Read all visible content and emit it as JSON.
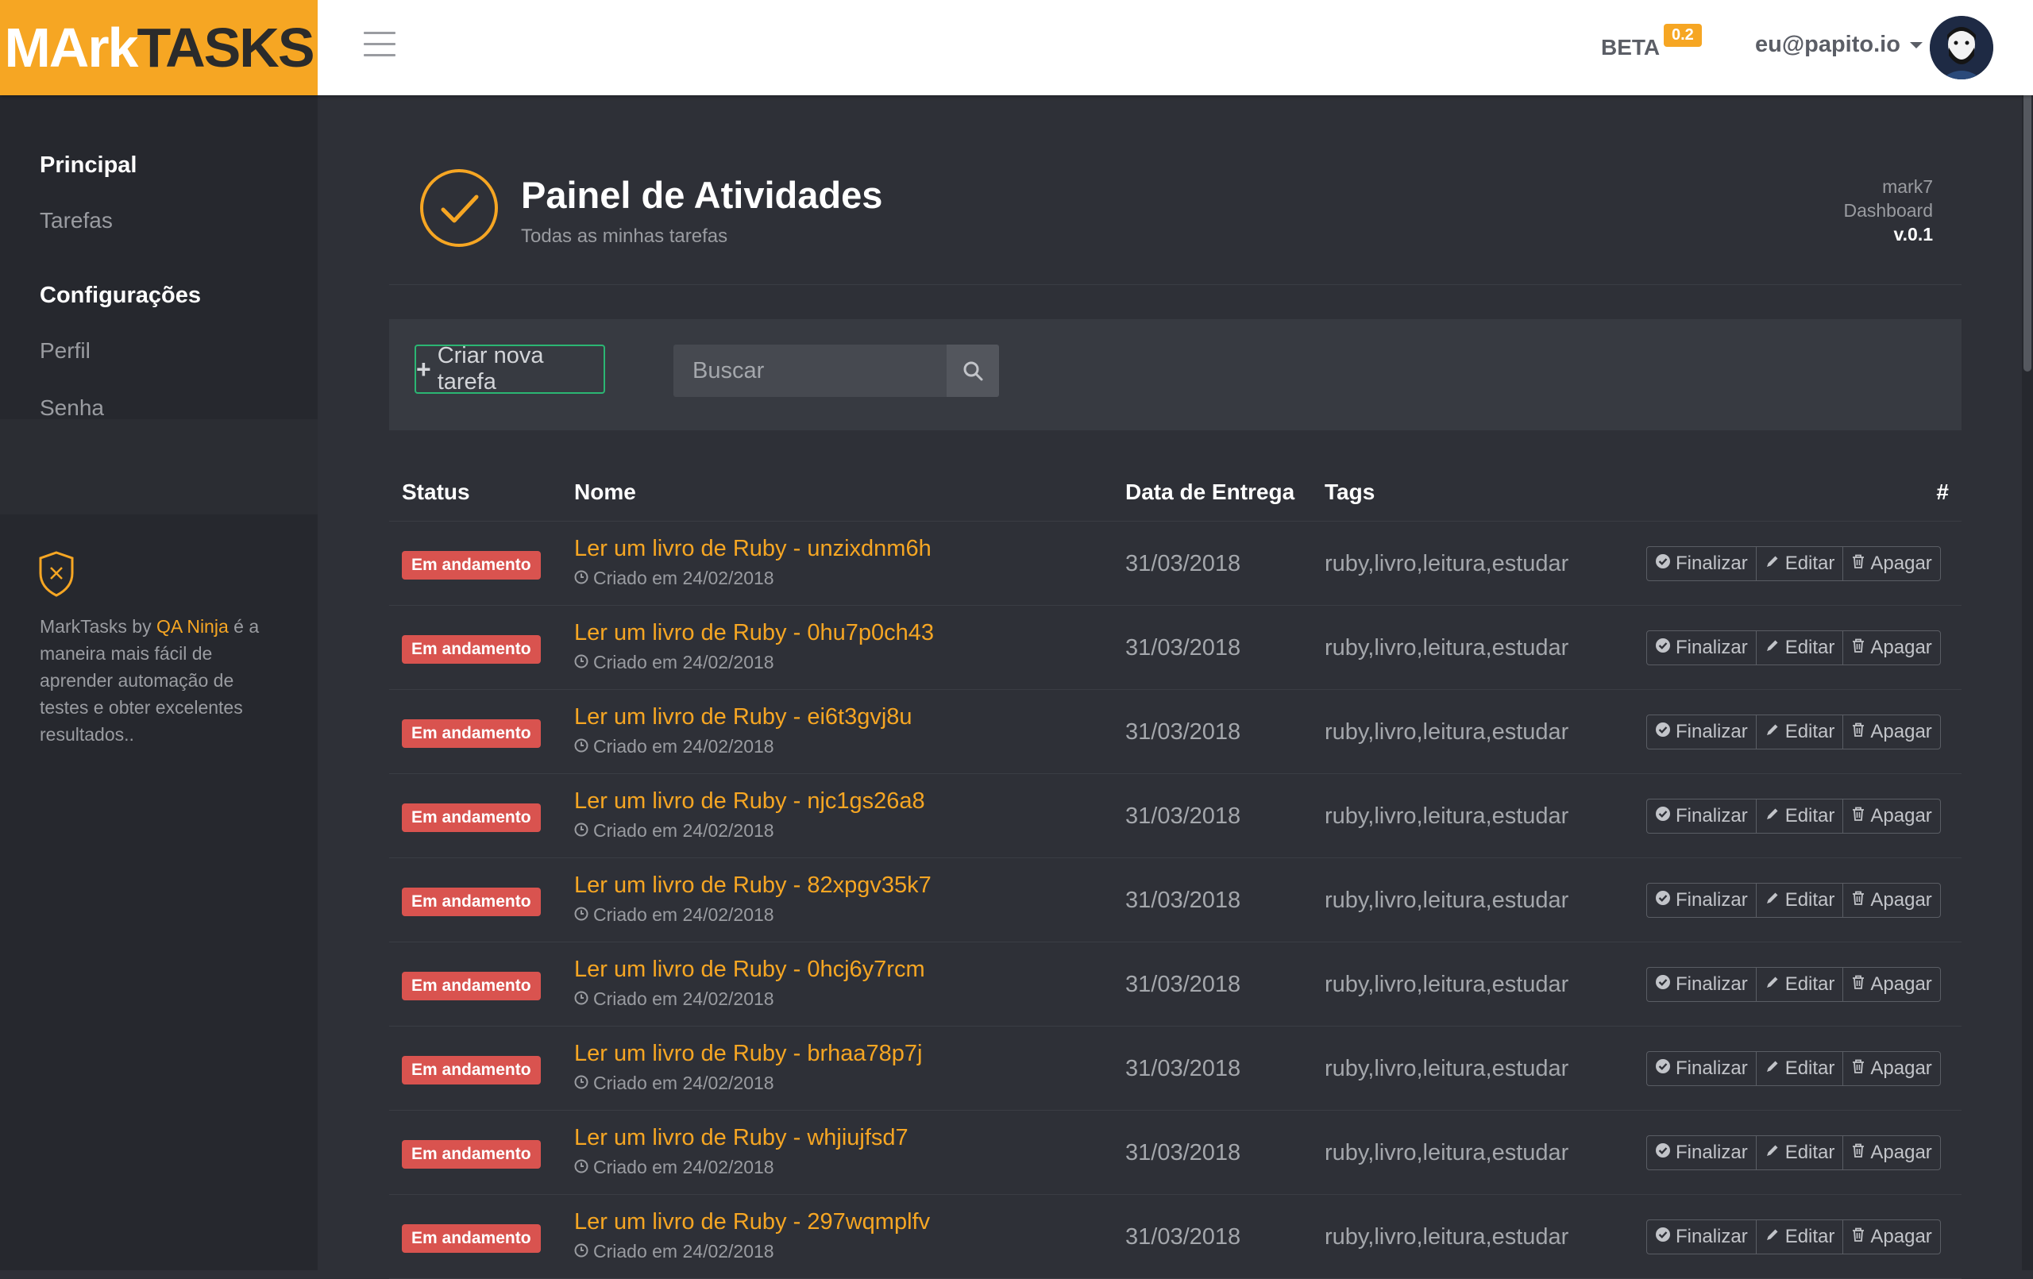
{
  "brand": {
    "mark": "MArk",
    "tasks": "TASKS",
    "primary_color": "#f6a623"
  },
  "topbar": {
    "menu_icon": "hamburger-icon",
    "beta_label": "BETA",
    "version_badge": "0.2",
    "user_email": "eu@papito.io"
  },
  "sidebar": {
    "group_main": "Principal",
    "item_tasks": "Tarefas",
    "group_settings": "Configurações",
    "item_profile": "Perfil",
    "item_password": "Senha",
    "about_prefix": "MarkTasks by ",
    "about_link": "QA Ninja",
    "about_suffix": " é a maneira mais fácil de aprender automação de testes e obter excelentes resultados.."
  },
  "header": {
    "title": "Painel de Atividades",
    "subtitle": "Todas as minhas tarefas",
    "meta_app": "mark7",
    "meta_section": "Dashboard",
    "meta_version": "v.0.1"
  },
  "toolbar": {
    "new_task_label": "Criar nova tarefa",
    "search_placeholder": "Buscar"
  },
  "table": {
    "columns": [
      "Status",
      "Nome",
      "Data de Entrega",
      "Tags",
      "#"
    ],
    "actions": {
      "finish": "Finalizar",
      "edit": "Editar",
      "delete": "Apagar"
    },
    "rows": [
      {
        "status": "Em andamento",
        "name": "Ler um livro de Ruby - unzixdnm6h",
        "created": "Criado em 24/02/2018",
        "due": "31/03/2018",
        "tags": "ruby,livro,leitura,estudar"
      },
      {
        "status": "Em andamento",
        "name": "Ler um livro de Ruby - 0hu7p0ch43",
        "created": "Criado em 24/02/2018",
        "due": "31/03/2018",
        "tags": "ruby,livro,leitura,estudar"
      },
      {
        "status": "Em andamento",
        "name": "Ler um livro de Ruby - ei6t3gvj8u",
        "created": "Criado em 24/02/2018",
        "due": "31/03/2018",
        "tags": "ruby,livro,leitura,estudar"
      },
      {
        "status": "Em andamento",
        "name": "Ler um livro de Ruby - njc1gs26a8",
        "created": "Criado em 24/02/2018",
        "due": "31/03/2018",
        "tags": "ruby,livro,leitura,estudar"
      },
      {
        "status": "Em andamento",
        "name": "Ler um livro de Ruby - 82xpgv35k7",
        "created": "Criado em 24/02/2018",
        "due": "31/03/2018",
        "tags": "ruby,livro,leitura,estudar"
      },
      {
        "status": "Em andamento",
        "name": "Ler um livro de Ruby - 0hcj6y7rcm",
        "created": "Criado em 24/02/2018",
        "due": "31/03/2018",
        "tags": "ruby,livro,leitura,estudar"
      },
      {
        "status": "Em andamento",
        "name": "Ler um livro de Ruby - brhaa78p7j",
        "created": "Criado em 24/02/2018",
        "due": "31/03/2018",
        "tags": "ruby,livro,leitura,estudar"
      },
      {
        "status": "Em andamento",
        "name": "Ler um livro de Ruby - whjiujfsd7",
        "created": "Criado em 24/02/2018",
        "due": "31/03/2018",
        "tags": "ruby,livro,leitura,estudar"
      },
      {
        "status": "Em andamento",
        "name": "Ler um livro de Ruby - 297wqmplfv",
        "created": "Criado em 24/02/2018",
        "due": "31/03/2018",
        "tags": "ruby,livro,leitura,estudar"
      }
    ]
  }
}
